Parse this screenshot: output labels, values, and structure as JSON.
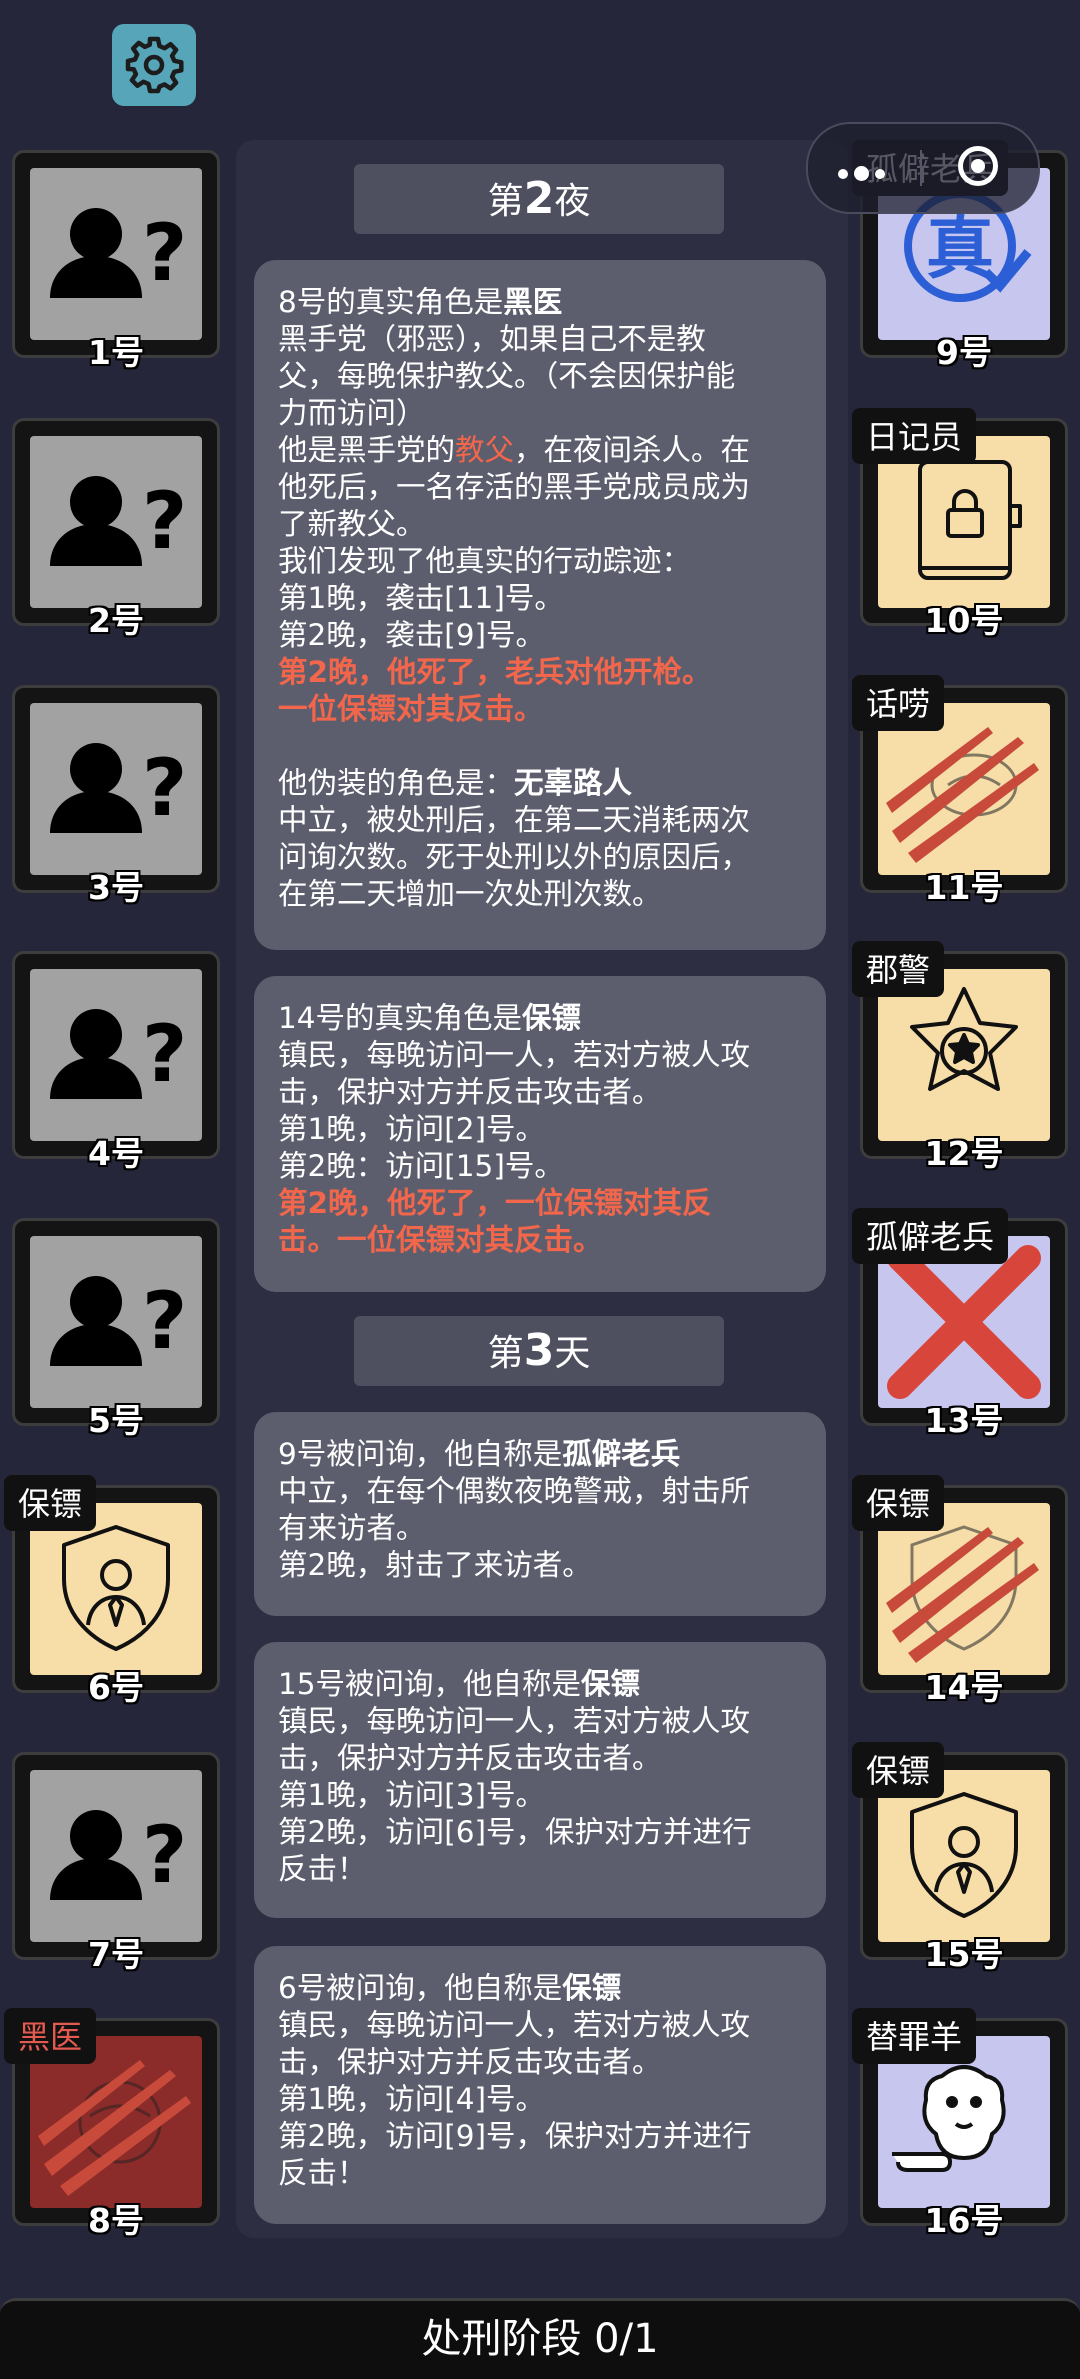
{
  "header": {
    "settings_icon": "gear-icon"
  },
  "capsule": {
    "menu_icon": "more-dots-icon",
    "close_icon": "target-icon"
  },
  "left_players": [
    {
      "num": "1号",
      "role": "",
      "style": "unknown",
      "icon": "unknown-user-icon"
    },
    {
      "num": "2号",
      "role": "",
      "style": "unknown",
      "icon": "unknown-user-icon"
    },
    {
      "num": "3号",
      "role": "",
      "style": "unknown",
      "icon": "unknown-user-icon"
    },
    {
      "num": "4号",
      "role": "",
      "style": "unknown",
      "icon": "unknown-user-icon"
    },
    {
      "num": "5号",
      "role": "",
      "style": "unknown",
      "icon": "unknown-user-icon"
    },
    {
      "num": "6号",
      "role": "保镖",
      "style": "tan",
      "icon": "bodyguard-shield-icon"
    },
    {
      "num": "7号",
      "role": "",
      "style": "unknown",
      "icon": "unknown-user-icon"
    },
    {
      "num": "8号",
      "role": "黑医",
      "style": "red",
      "icon": "claw-scratch-icon"
    }
  ],
  "right_players": [
    {
      "num": "9号",
      "role": "孤僻老兵",
      "style": "lav",
      "icon": "true-stamp-icon"
    },
    {
      "num": "10号",
      "role": "日记员",
      "style": "tan",
      "icon": "locked-diary-icon"
    },
    {
      "num": "11号",
      "role": "话唠",
      "style": "tan",
      "icon": "claw-scratch-icon"
    },
    {
      "num": "12号",
      "role": "郡警",
      "style": "tan",
      "icon": "sheriff-star-icon"
    },
    {
      "num": "13号",
      "role": "孤僻老兵",
      "style": "lav",
      "icon": "red-x-icon"
    },
    {
      "num": "14号",
      "role": "保镖",
      "style": "tan",
      "icon": "claw-scratch-icon"
    },
    {
      "num": "15号",
      "role": "保镖",
      "style": "tan",
      "icon": "bodyguard-shield-icon"
    },
    {
      "num": "16号",
      "role": "替罪羊",
      "style": "lav",
      "icon": "scapegoat-sheep-icon"
    }
  ],
  "log": {
    "night_header": {
      "prefix": "第",
      "num": "2",
      "suffix": "夜"
    },
    "day_header": {
      "prefix": "第",
      "num": "3",
      "suffix": "天"
    },
    "msg1": {
      "l1a": "8号的真实角色是",
      "l1b": "黑医",
      "l2": "黑手党（邪恶），如果自己不是教",
      "l3": "父，每晚保护教父。（不会因保护能",
      "l4": "力而访问）",
      "l5a": "他是黑手党的",
      "l5b": "教父",
      "l5c": "，在夜间杀人。在",
      "l6": "他死后，一名存活的黑手党成员成为",
      "l7": "了新教父。",
      "l8": "我们发现了他真实的行动踪迹：",
      "l9": "第1晚，袭击[11]号。",
      "l10": "第2晚，袭击[9]号。",
      "l11": "第2晚，他死了，老兵对他开枪。",
      "l12": "一位保镖对其反击。",
      "l13a": "他伪装的角色是：",
      "l13b": "无辜路人",
      "l14": "中立，被处刑后，在第二天消耗两次",
      "l15": "问询次数。死于处刑以外的原因后，",
      "l16": "在第二天增加一次处刑次数。"
    },
    "msg2": {
      "l1a": "14号的真实角色是",
      "l1b": "保镖",
      "l2": "镇民，每晚访问一人，若对方被人攻",
      "l3": "击，保护对方并反击攻击者。",
      "l4": "第1晚，访问[2]号。",
      "l5": "第2晚：访问[15]号。",
      "l6": "第2晚，他死了，一位保镖对其反",
      "l7": "击。一位保镖对其反击。"
    },
    "msg3": {
      "l1a": "9号被问询，他自称是",
      "l1b": "孤僻老兵",
      "l2": "中立，在每个偶数夜晚警戒，射击所",
      "l3": "有来访者。",
      "l4": "第2晚，射击了来访者。"
    },
    "msg4": {
      "l1a": "15号被问询，他自称是",
      "l1b": "保镖",
      "l2": "镇民，每晚访问一人，若对方被人攻",
      "l3": "击，保护对方并反击攻击者。",
      "l4": "第1晚，访问[3]号。",
      "l5": "第2晚，访问[6]号，保护对方并进行",
      "l6": "反击！"
    },
    "msg5": {
      "l1a": "6号被问询，他自称是",
      "l1b": "保镖",
      "l2": "镇民，每晚访问一人，若对方被人攻",
      "l3": "击，保护对方并反击攻击者。",
      "l4": "第1晚，访问[4]号。",
      "l5": "第2晚，访问[9]号，保护对方并进行",
      "l6": "反击！"
    }
  },
  "footer": {
    "label": "处刑阶段 0/1"
  },
  "colors": {
    "background": "#252639",
    "accent_red": "#f2664b",
    "tan": "#f7dea8",
    "lavender": "#c7c6ef"
  }
}
